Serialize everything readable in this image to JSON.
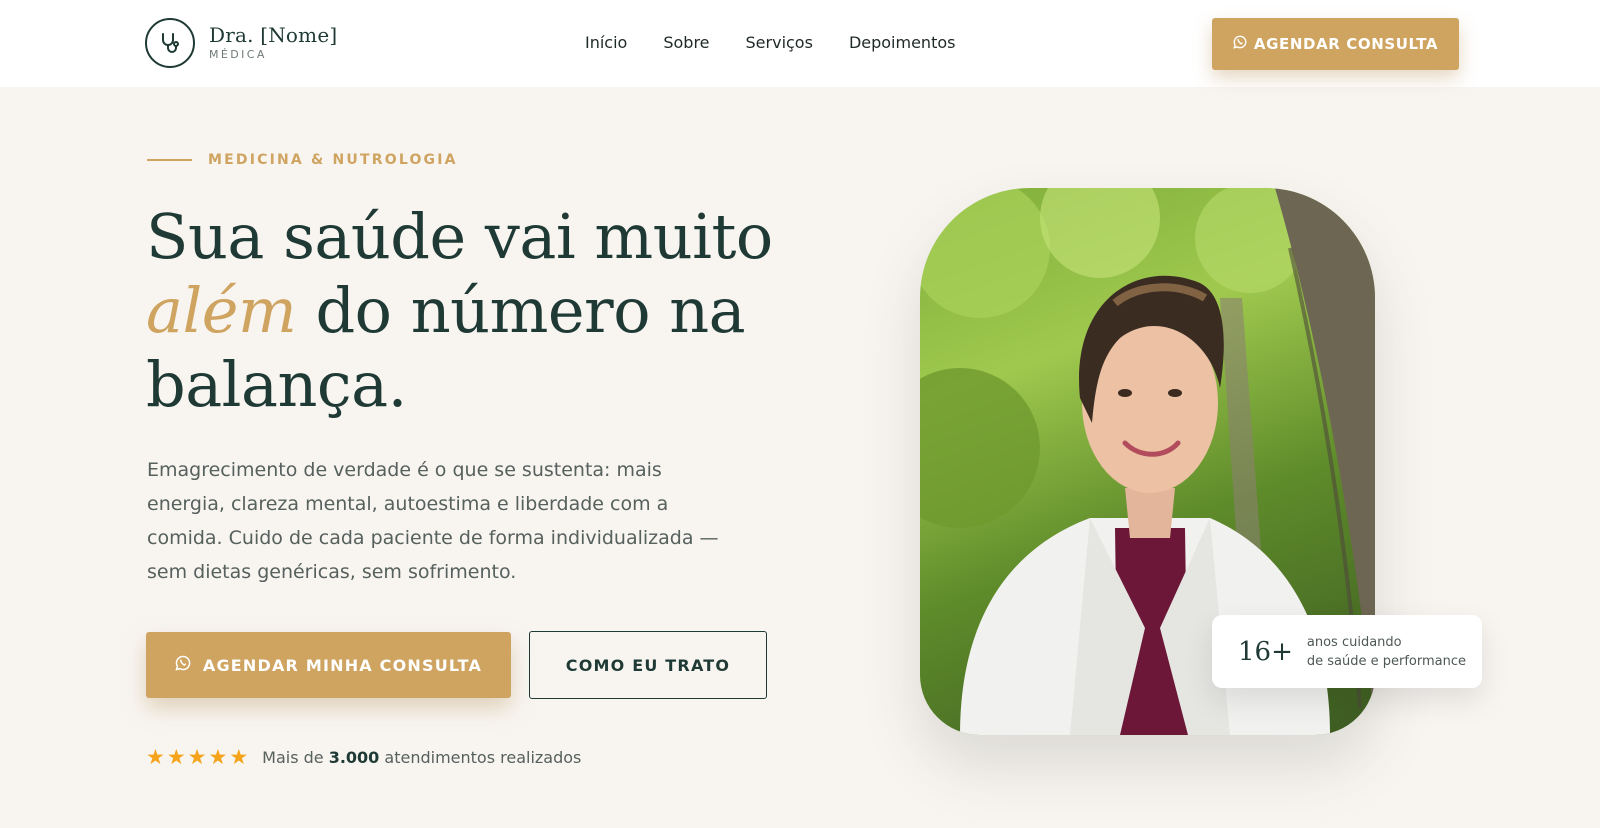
{
  "header": {
    "logo_name": "Dra. [Nome]",
    "logo_sub": "MÉDICA",
    "nav": [
      "Início",
      "Sobre",
      "Serviços",
      "Depoimentos"
    ],
    "cta": "AGENDAR CONSULTA"
  },
  "hero": {
    "eyebrow": "MEDICINA & NUTROLOGIA",
    "headline_line1": "Sua saúde vai muito",
    "headline_accent": "além",
    "headline_line2_rest": " do número na",
    "headline_line3": "balança.",
    "lead": "Emagrecimento de verdade é o que se sustenta: mais energia, clareza mental, autoestima e liberdade com a comida. Cuido de cada paciente de forma individualizada — sem dietas genéricas, sem sofrimento.",
    "primary_button": "AGENDAR MINHA CONSULTA",
    "secondary_button": "COMO EU TRATO",
    "rating_stars": 5,
    "rating_prefix": "Mais de ",
    "rating_count": "3.000",
    "rating_suffix": " atendimentos realizados"
  },
  "stat": {
    "number": "16+",
    "label_line1": "anos cuidando",
    "label_line2": "de saúde e performance"
  },
  "colors": {
    "accent": "#cfa461",
    "primary": "#1f3a35",
    "background": "#f8f5f1",
    "star": "#f5a31a"
  },
  "icons": {
    "logo": "stethoscope-icon",
    "cta": "whatsapp-icon",
    "rating": "star-icon"
  }
}
